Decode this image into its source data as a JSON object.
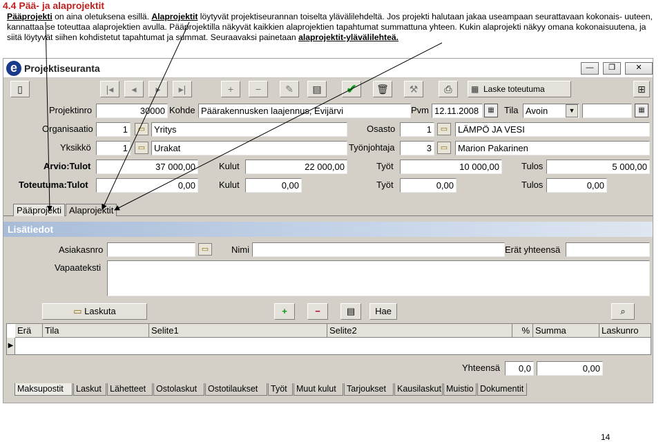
{
  "doc": {
    "heading": "4.4 Pää- ja alaprojektit",
    "para_parts": [
      {
        "t": "Pääprojekti",
        "u": true
      },
      {
        "t": " on aina oletuksena esillä. ",
        "u": false
      },
      {
        "t": "Alaprojektit",
        "u": true
      },
      {
        "t": " löytyvät projektiseurannan toiselta ylävälilehdeltä. Jos projekti halutaan jakaa useampaan seurattavaan kokonais- uuteen, kannattaa se toteuttaa alaprojektien avulla. Pääprojektilla näkyvät kaikkien alaprojektien tapahtumat summattuna yhteen. Kukin alaprojekti näkyy omana kokonaisuutena, ja siitä löytyvät siihen kohdistetut tapahtumat ja summat. Seuraavaksi painetaan ",
        "u": false
      },
      {
        "t": "alaprojektit-ylävälilehteä.",
        "u": true
      }
    ],
    "page_number": "14"
  },
  "window": {
    "logo_letter": "e",
    "title": "Projektiseuranta",
    "controls": [
      "—",
      "❐",
      "✕"
    ]
  },
  "toolbar": {
    "report_button": "Laske toteutuma"
  },
  "form": {
    "projektinro_label": "Projektinro",
    "projektinro_value": "30000",
    "kohde_label": "Kohde",
    "kohde_value": "Päärakennusken laajennus, Evijärvi",
    "pvm_label": "Pvm",
    "pvm_value": "12.11.2008",
    "tila_label": "Tila",
    "tila_value": "Avoin",
    "organisaatio_label": "Organisaatio",
    "organisaatio_no": "1",
    "organisaatio_value": "Yritys",
    "osasto_label": "Osasto",
    "osasto_no": "1",
    "osasto_value": "LÄMPÖ JA VESI",
    "yksikko_label": "Yksikkö",
    "yksikko_no": "1",
    "yksikko_value": "Urakat",
    "tyonjohtaja_label": "Työnjohtaja",
    "tyonjohtaja_no": "3",
    "tyonjohtaja_value": "Marion Pakarinen",
    "arvio_label": "Arvio:Tulot",
    "arvio_tulot": "37 000,00",
    "kulut_label": "Kulut",
    "arvio_kulut": "22 000,00",
    "tyot_label": "Työt",
    "arvio_tyot": "10 000,00",
    "tulos_label": "Tulos",
    "arvio_tulos": "5 000,00",
    "toteutuma_label": "Toteutuma:Tulot",
    "tot_tulot": "0,00",
    "tot_kulut": "0,00",
    "tot_tyot": "0,00",
    "tot_tulos": "0,00"
  },
  "tabs": {
    "paaprojekti": "Pääprojekti",
    "alaprojektit": "Alaprojektit"
  },
  "lisatiedot": {
    "section_title": "Lisätiedot",
    "asiakasnro_label": "Asiakasnro",
    "nimi_label": "Nimi",
    "erat_label": "Erät yhteensä",
    "vapaateksti_label": "Vapaateksti",
    "laskuta_button": "Laskuta",
    "hae_button": "Hae"
  },
  "grid": {
    "columns": [
      "Erä",
      "Tila",
      "Selite1",
      "Selite2",
      "%",
      "Summa",
      "Laskunro"
    ],
    "yhteensa_label": "Yhteensä",
    "total_pct": "0,0",
    "total_sum": "0,00"
  },
  "bottom_tabs": [
    "Maksupostit",
    "Laskut",
    "Lähetteet",
    "Ostolaskut",
    "Ostotilaukset",
    "Työt",
    "Muut kulut",
    "Tarjoukset",
    "Kausilaskut",
    "Muistio",
    "Dokumentit"
  ]
}
